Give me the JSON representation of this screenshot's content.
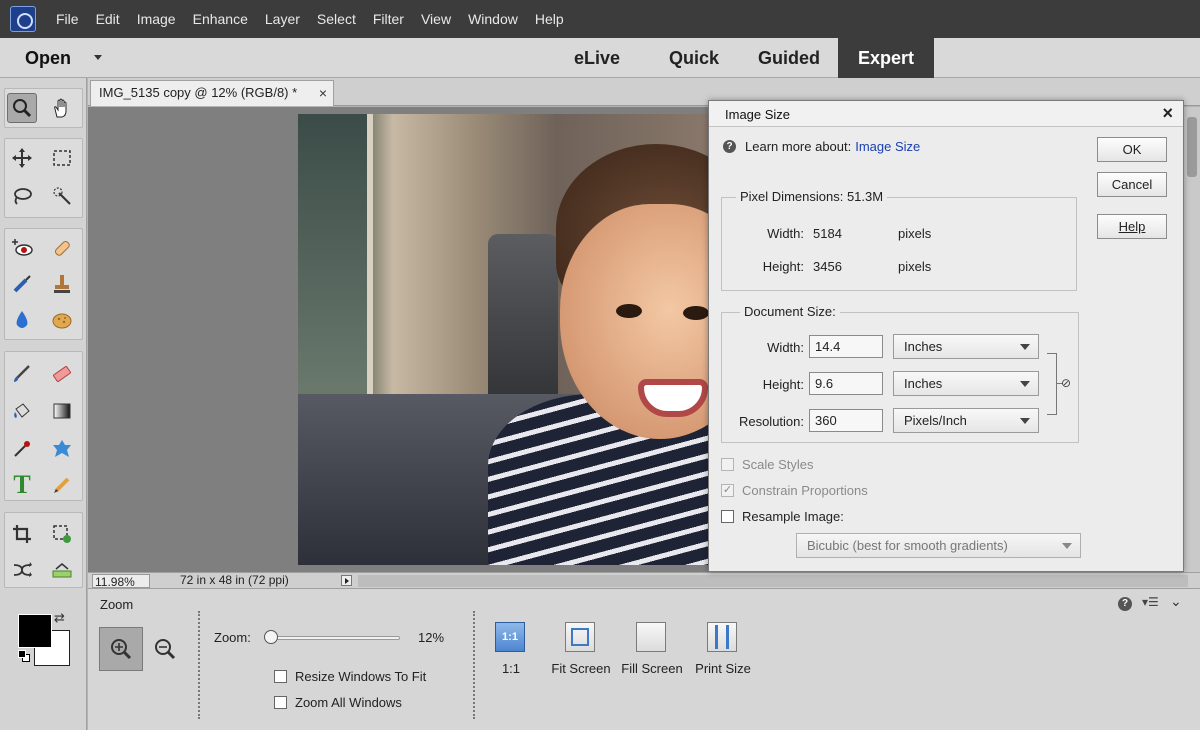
{
  "menubar": {
    "items": [
      "File",
      "Edit",
      "Image",
      "Enhance",
      "Layer",
      "Select",
      "Filter",
      "View",
      "Window",
      "Help"
    ]
  },
  "modebar": {
    "open_label": "Open",
    "tabs": [
      "eLive",
      "Quick",
      "Guided",
      "Expert"
    ],
    "active_tab": "Expert"
  },
  "document": {
    "tab_title": "IMG_5135 copy @ 12% (RGB/8) *",
    "close_glyph": "×"
  },
  "status": {
    "zoom": "11.98%",
    "info": "72 in x 48 in (72 ppi)"
  },
  "tools": {
    "icons": [
      "zoom-icon",
      "hand-icon",
      "move-icon",
      "marquee-icon",
      "lasso-icon",
      "quick-selection-icon",
      "red-eye-icon",
      "spot-healing-icon",
      "smart-brush-icon",
      "clone-stamp-icon",
      "blur-icon",
      "sponge-icon",
      "brush-icon",
      "eraser-icon",
      "paint-bucket-icon",
      "gradient-icon",
      "eyedropper-icon",
      "custom-shape-icon",
      "type-icon",
      "pencil-icon",
      "crop-icon",
      "recompose-icon",
      "content-aware-move-icon",
      "straighten-icon"
    ],
    "type_glyph": "T"
  },
  "options": {
    "title": "Zoom",
    "zoom_label": "Zoom:",
    "zoom_value": "12%",
    "zoom_fraction": 0.0,
    "resize_windows": "Resize Windows To Fit",
    "zoom_all": "Zoom All Windows",
    "view_buttons": [
      {
        "label": "1:1",
        "icon_text": "1:1"
      },
      {
        "label": "Fit Screen"
      },
      {
        "label": "Fill Screen"
      },
      {
        "label": "Print Size"
      }
    ],
    "help_glyph": "?"
  },
  "dialog": {
    "title": "Image Size",
    "close_glyph": "×",
    "learn_prefix": "Learn more about:",
    "learn_link": "Image Size",
    "help_glyph": "?",
    "pixel_dimensions": {
      "legend": "Pixel Dimensions:",
      "size": "51.3M",
      "width_label": "Width:",
      "width": "5184",
      "width_unit": "pixels",
      "height_label": "Height:",
      "height": "3456",
      "height_unit": "pixels"
    },
    "document_size": {
      "legend": "Document Size:",
      "width_label": "Width:",
      "width": "14.4",
      "width_unit": "Inches",
      "height_label": "Height:",
      "height": "9.6",
      "height_unit": "Inches",
      "resolution_label": "Resolution:",
      "resolution": "360",
      "resolution_unit": "Pixels/Inch"
    },
    "scale_styles": "Scale Styles",
    "constrain_proportions": "Constrain Proportions",
    "resample_image": "Resample Image:",
    "resample_method": "Bicubic (best for smooth gradients)",
    "buttons": {
      "ok": "OK",
      "cancel": "Cancel",
      "help": "Help"
    }
  }
}
